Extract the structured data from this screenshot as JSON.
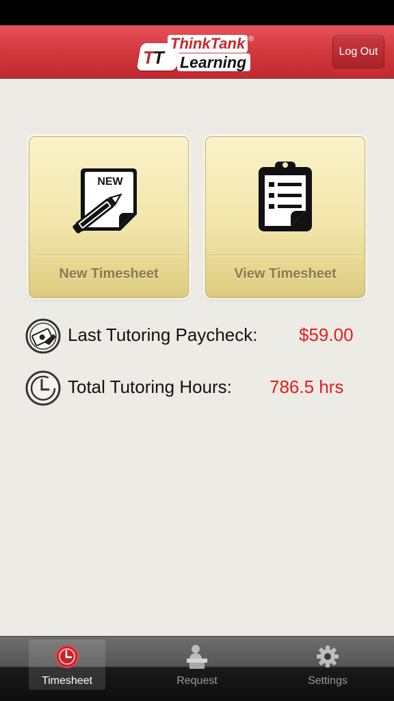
{
  "header": {
    "logo": {
      "think": "Think",
      "tank": "Tank",
      "learning": "Learning",
      "tt": "TT",
      "registered": "®"
    },
    "logout_label": "Log Out"
  },
  "tiles": [
    {
      "label": "New Timesheet",
      "badge": "NEW",
      "icon": "new-document-pencil-icon"
    },
    {
      "label": "View Timesheet",
      "icon": "clipboard-list-icon"
    }
  ],
  "stats": {
    "paycheck": {
      "label": "Last Tutoring Paycheck:",
      "value": "$59.00",
      "icon": "money-hand-icon"
    },
    "hours": {
      "label": "Total Tutoring Hours:",
      "value": "786.5 hrs",
      "icon": "clock-icon"
    }
  },
  "tabbar": {
    "items": [
      {
        "label": "Timesheet",
        "icon": "clock-icon",
        "active": true
      },
      {
        "label": "Request",
        "icon": "person-desk-icon",
        "active": false
      },
      {
        "label": "Settings",
        "icon": "gear-icon",
        "active": false
      }
    ]
  },
  "colors": {
    "header_red": "#d23a40",
    "value_red": "#e61c1c",
    "tile_gold": "#f2e6ab"
  }
}
